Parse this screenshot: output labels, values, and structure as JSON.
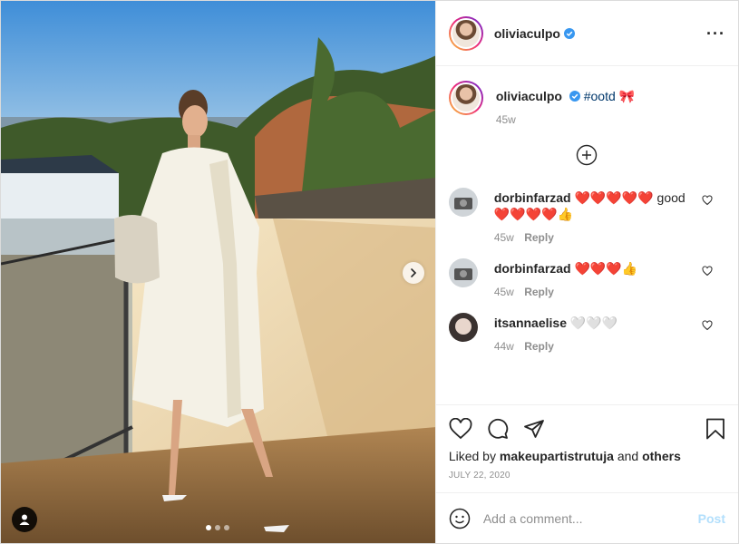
{
  "post": {
    "username": "oliviaculpo",
    "verified": true,
    "more_icon": "more-horizontal-icon",
    "carousel": {
      "slides": 3,
      "active": 1
    }
  },
  "caption": {
    "username": "oliviaculpo",
    "hashtag": "#ootd",
    "emoji": "🎀",
    "time": "45w"
  },
  "load_more_icon": "plus-circle-icon",
  "comments": [
    {
      "username": "dorbinfarzad",
      "text": "❤️❤️❤️❤️❤️ good❤️❤️❤️❤️👍",
      "time": "45w",
      "reply": "Reply"
    },
    {
      "username": "dorbinfarzad",
      "text": "❤️❤️❤️👍",
      "time": "45w",
      "reply": "Reply"
    },
    {
      "username": "itsannaelise",
      "text": "🤍🤍🤍",
      "time": "44w",
      "reply": "Reply"
    }
  ],
  "likes": {
    "prefix": "Liked by",
    "user": "makeupartistrutuja",
    "joiner": "and",
    "others": "others"
  },
  "date": "JULY 22, 2020",
  "add_comment": {
    "placeholder": "Add a comment...",
    "post_label": "Post"
  },
  "colors": {
    "verified": "#3897f0",
    "link": "#00376b",
    "post_disabled": "#b2dffc",
    "heart": "#e0102a"
  }
}
